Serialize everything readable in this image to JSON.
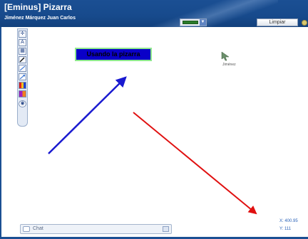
{
  "app": {
    "title": "[Eminus] Pizarra",
    "user_name": "Jiménez Márquez Juan Carlos"
  },
  "header": {
    "clear_button_label": "Limpiar",
    "selected_color": "#2a7a2a",
    "brand_color": "#1b4f93"
  },
  "toolbar": {
    "tools": [
      {
        "name": "move-tool-icon"
      },
      {
        "name": "text-tool-icon"
      },
      {
        "name": "image-tool-icon"
      },
      {
        "name": "arrow-tool-icon"
      },
      {
        "name": "line-tool-icon"
      },
      {
        "name": "arrow-diagonal-tool-icon"
      },
      {
        "name": "color-palette-icon"
      },
      {
        "name": "chart-tool-icon"
      },
      {
        "name": "settings-tool-icon"
      }
    ]
  },
  "canvas": {
    "text_box": "Usando la pizarra",
    "remote_cursor_label": "Jiménez",
    "strokes": [
      {
        "color": "#1a1ad0",
        "label": "blue-arrow"
      },
      {
        "color": "#e01010",
        "label": "red-arrow"
      }
    ]
  },
  "chat": {
    "label": "Chat"
  },
  "coordinates": {
    "x_text": "X: 400.95",
    "y_text": "Y: 111"
  }
}
